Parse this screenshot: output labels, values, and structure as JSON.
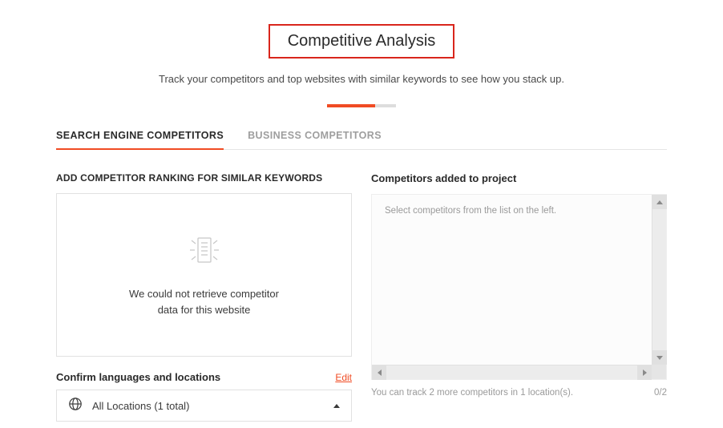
{
  "hero": {
    "title": "Competitive Analysis",
    "subtitle": "Track your competitors and top websites with similar keywords to see how you stack up."
  },
  "tabs": {
    "search": "SEARCH ENGINE COMPETITORS",
    "business": "BUSINESS COMPETITORS"
  },
  "left": {
    "heading": "ADD COMPETITOR RANKING FOR SIMILAR KEYWORDS",
    "empty_line1": "We could not retrieve competitor",
    "empty_line2": "data for this website",
    "lang_title": "Confirm languages and locations",
    "edit": "Edit",
    "location_label": "All Locations (1 total)"
  },
  "right": {
    "heading": "Competitors added to project",
    "placeholder": "Select competitors from the list on the left.",
    "foot_msg": "You can track 2 more competitors in 1 location(s).",
    "counter": "0/2"
  }
}
